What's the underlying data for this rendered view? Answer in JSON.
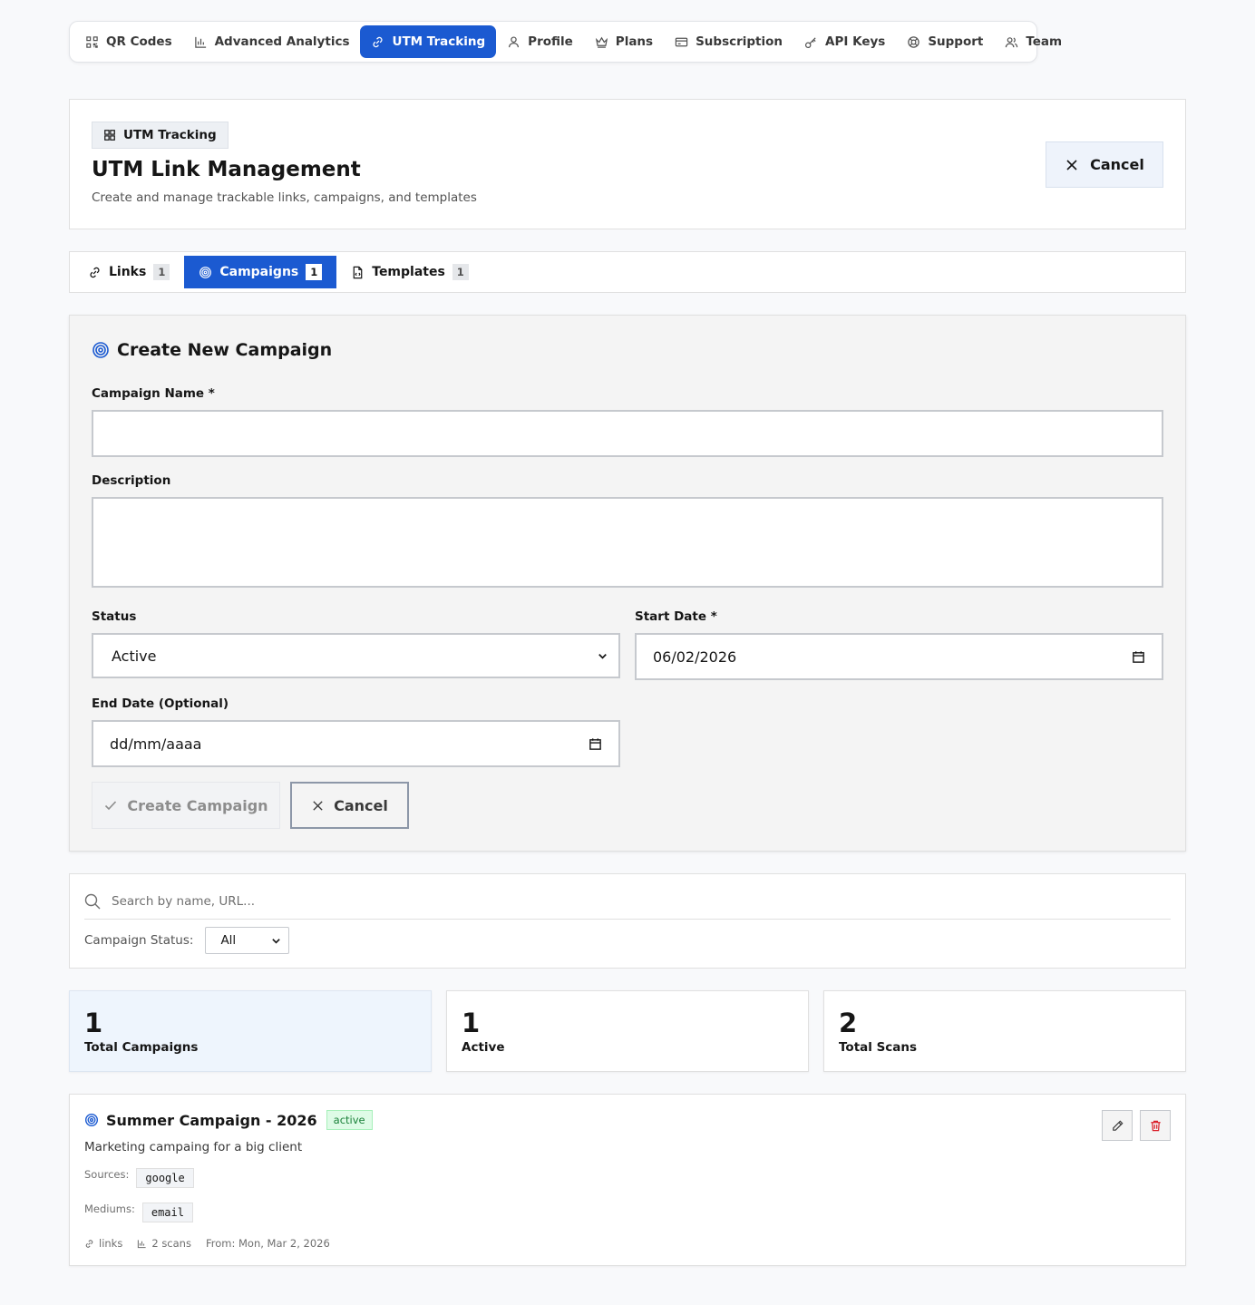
{
  "nav": {
    "items": [
      {
        "label": "QR Codes",
        "icon": "qr-code-icon"
      },
      {
        "label": "Advanced Analytics",
        "icon": "bar-chart-icon"
      },
      {
        "label": "UTM Tracking",
        "icon": "link-icon",
        "active": true
      },
      {
        "label": "Profile",
        "icon": "user-icon"
      },
      {
        "label": "Plans",
        "icon": "crown-icon"
      },
      {
        "label": "Subscription",
        "icon": "credit-card-icon"
      },
      {
        "label": "API Keys",
        "icon": "key-icon"
      },
      {
        "label": "Support",
        "icon": "lifebuoy-icon"
      },
      {
        "label": "Team",
        "icon": "users-icon"
      }
    ]
  },
  "header": {
    "breadcrumb": "UTM Tracking",
    "title": "UTM Link Management",
    "subtitle": "Create and manage trackable links, campaigns, and templates",
    "cancel_label": "Cancel"
  },
  "tabs": [
    {
      "label": "Links",
      "count": "1",
      "icon": "link-icon"
    },
    {
      "label": "Campaigns",
      "count": "1",
      "icon": "target-icon",
      "active": true
    },
    {
      "label": "Templates",
      "count": "1",
      "icon": "document-icon"
    }
  ],
  "form": {
    "title": "Create New Campaign",
    "name_label": "Campaign Name *",
    "name_value": "",
    "description_label": "Description",
    "description_value": "",
    "status_label": "Status",
    "status_value": "Active",
    "start_date_label": "Start Date *",
    "start_date_value": "06/02/2026",
    "end_date_label": "End Date (Optional)",
    "end_date_value": "dd/mm/aaaa",
    "create_label": "Create Campaign",
    "cancel_label": "Cancel"
  },
  "filters": {
    "search_placeholder": "Search by name, URL...",
    "status_label": "Campaign Status:",
    "status_value": "All"
  },
  "stats": [
    {
      "value": "1",
      "label": "Total Campaigns"
    },
    {
      "value": "1",
      "label": "Active"
    },
    {
      "value": "2",
      "label": "Total Scans"
    }
  ],
  "campaign": {
    "name": "Summer Campaign - 2026",
    "status": "active",
    "description": "Marketing campaing for a big client",
    "sources_label": "Sources:",
    "source": "google",
    "mediums_label": "Mediums:",
    "medium": "email",
    "links_text": "links",
    "scans_text": "2 scans",
    "from_text": "From: Mon, Mar 2, 2026"
  },
  "colors": {
    "accent": "#1b5ad1",
    "badge_green": "#198038",
    "danger": "#da1e28"
  }
}
